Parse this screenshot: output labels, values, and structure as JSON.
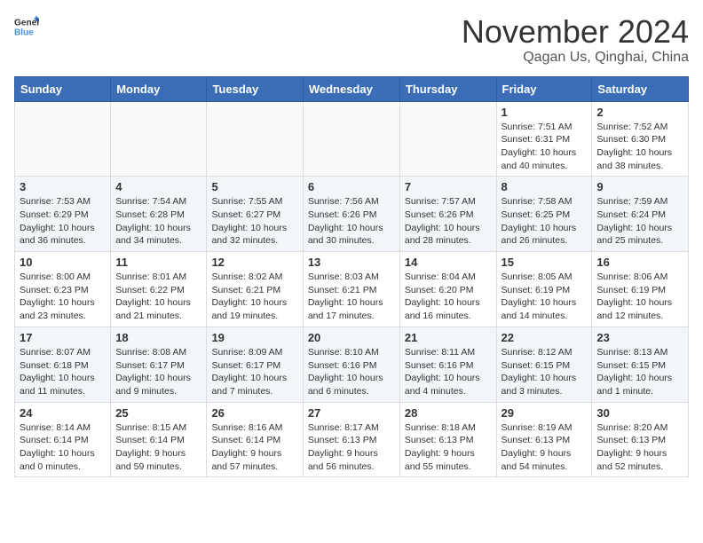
{
  "header": {
    "logo_general": "General",
    "logo_blue": "Blue",
    "month_title": "November 2024",
    "subtitle": "Qagan Us, Qinghai, China"
  },
  "calendar": {
    "days_of_week": [
      "Sunday",
      "Monday",
      "Tuesday",
      "Wednesday",
      "Thursday",
      "Friday",
      "Saturday"
    ],
    "weeks": [
      [
        {
          "day": "",
          "info": ""
        },
        {
          "day": "",
          "info": ""
        },
        {
          "day": "",
          "info": ""
        },
        {
          "day": "",
          "info": ""
        },
        {
          "day": "",
          "info": ""
        },
        {
          "day": "1",
          "info": "Sunrise: 7:51 AM\nSunset: 6:31 PM\nDaylight: 10 hours and 40 minutes."
        },
        {
          "day": "2",
          "info": "Sunrise: 7:52 AM\nSunset: 6:30 PM\nDaylight: 10 hours and 38 minutes."
        }
      ],
      [
        {
          "day": "3",
          "info": "Sunrise: 7:53 AM\nSunset: 6:29 PM\nDaylight: 10 hours and 36 minutes."
        },
        {
          "day": "4",
          "info": "Sunrise: 7:54 AM\nSunset: 6:28 PM\nDaylight: 10 hours and 34 minutes."
        },
        {
          "day": "5",
          "info": "Sunrise: 7:55 AM\nSunset: 6:27 PM\nDaylight: 10 hours and 32 minutes."
        },
        {
          "day": "6",
          "info": "Sunrise: 7:56 AM\nSunset: 6:26 PM\nDaylight: 10 hours and 30 minutes."
        },
        {
          "day": "7",
          "info": "Sunrise: 7:57 AM\nSunset: 6:26 PM\nDaylight: 10 hours and 28 minutes."
        },
        {
          "day": "8",
          "info": "Sunrise: 7:58 AM\nSunset: 6:25 PM\nDaylight: 10 hours and 26 minutes."
        },
        {
          "day": "9",
          "info": "Sunrise: 7:59 AM\nSunset: 6:24 PM\nDaylight: 10 hours and 25 minutes."
        }
      ],
      [
        {
          "day": "10",
          "info": "Sunrise: 8:00 AM\nSunset: 6:23 PM\nDaylight: 10 hours and 23 minutes."
        },
        {
          "day": "11",
          "info": "Sunrise: 8:01 AM\nSunset: 6:22 PM\nDaylight: 10 hours and 21 minutes."
        },
        {
          "day": "12",
          "info": "Sunrise: 8:02 AM\nSunset: 6:21 PM\nDaylight: 10 hours and 19 minutes."
        },
        {
          "day": "13",
          "info": "Sunrise: 8:03 AM\nSunset: 6:21 PM\nDaylight: 10 hours and 17 minutes."
        },
        {
          "day": "14",
          "info": "Sunrise: 8:04 AM\nSunset: 6:20 PM\nDaylight: 10 hours and 16 minutes."
        },
        {
          "day": "15",
          "info": "Sunrise: 8:05 AM\nSunset: 6:19 PM\nDaylight: 10 hours and 14 minutes."
        },
        {
          "day": "16",
          "info": "Sunrise: 8:06 AM\nSunset: 6:19 PM\nDaylight: 10 hours and 12 minutes."
        }
      ],
      [
        {
          "day": "17",
          "info": "Sunrise: 8:07 AM\nSunset: 6:18 PM\nDaylight: 10 hours and 11 minutes."
        },
        {
          "day": "18",
          "info": "Sunrise: 8:08 AM\nSunset: 6:17 PM\nDaylight: 10 hours and 9 minutes."
        },
        {
          "day": "19",
          "info": "Sunrise: 8:09 AM\nSunset: 6:17 PM\nDaylight: 10 hours and 7 minutes."
        },
        {
          "day": "20",
          "info": "Sunrise: 8:10 AM\nSunset: 6:16 PM\nDaylight: 10 hours and 6 minutes."
        },
        {
          "day": "21",
          "info": "Sunrise: 8:11 AM\nSunset: 6:16 PM\nDaylight: 10 hours and 4 minutes."
        },
        {
          "day": "22",
          "info": "Sunrise: 8:12 AM\nSunset: 6:15 PM\nDaylight: 10 hours and 3 minutes."
        },
        {
          "day": "23",
          "info": "Sunrise: 8:13 AM\nSunset: 6:15 PM\nDaylight: 10 hours and 1 minute."
        }
      ],
      [
        {
          "day": "24",
          "info": "Sunrise: 8:14 AM\nSunset: 6:14 PM\nDaylight: 10 hours and 0 minutes."
        },
        {
          "day": "25",
          "info": "Sunrise: 8:15 AM\nSunset: 6:14 PM\nDaylight: 9 hours and 59 minutes."
        },
        {
          "day": "26",
          "info": "Sunrise: 8:16 AM\nSunset: 6:14 PM\nDaylight: 9 hours and 57 minutes."
        },
        {
          "day": "27",
          "info": "Sunrise: 8:17 AM\nSunset: 6:13 PM\nDaylight: 9 hours and 56 minutes."
        },
        {
          "day": "28",
          "info": "Sunrise: 8:18 AM\nSunset: 6:13 PM\nDaylight: 9 hours and 55 minutes."
        },
        {
          "day": "29",
          "info": "Sunrise: 8:19 AM\nSunset: 6:13 PM\nDaylight: 9 hours and 54 minutes."
        },
        {
          "day": "30",
          "info": "Sunrise: 8:20 AM\nSunset: 6:13 PM\nDaylight: 9 hours and 52 minutes."
        }
      ]
    ]
  }
}
